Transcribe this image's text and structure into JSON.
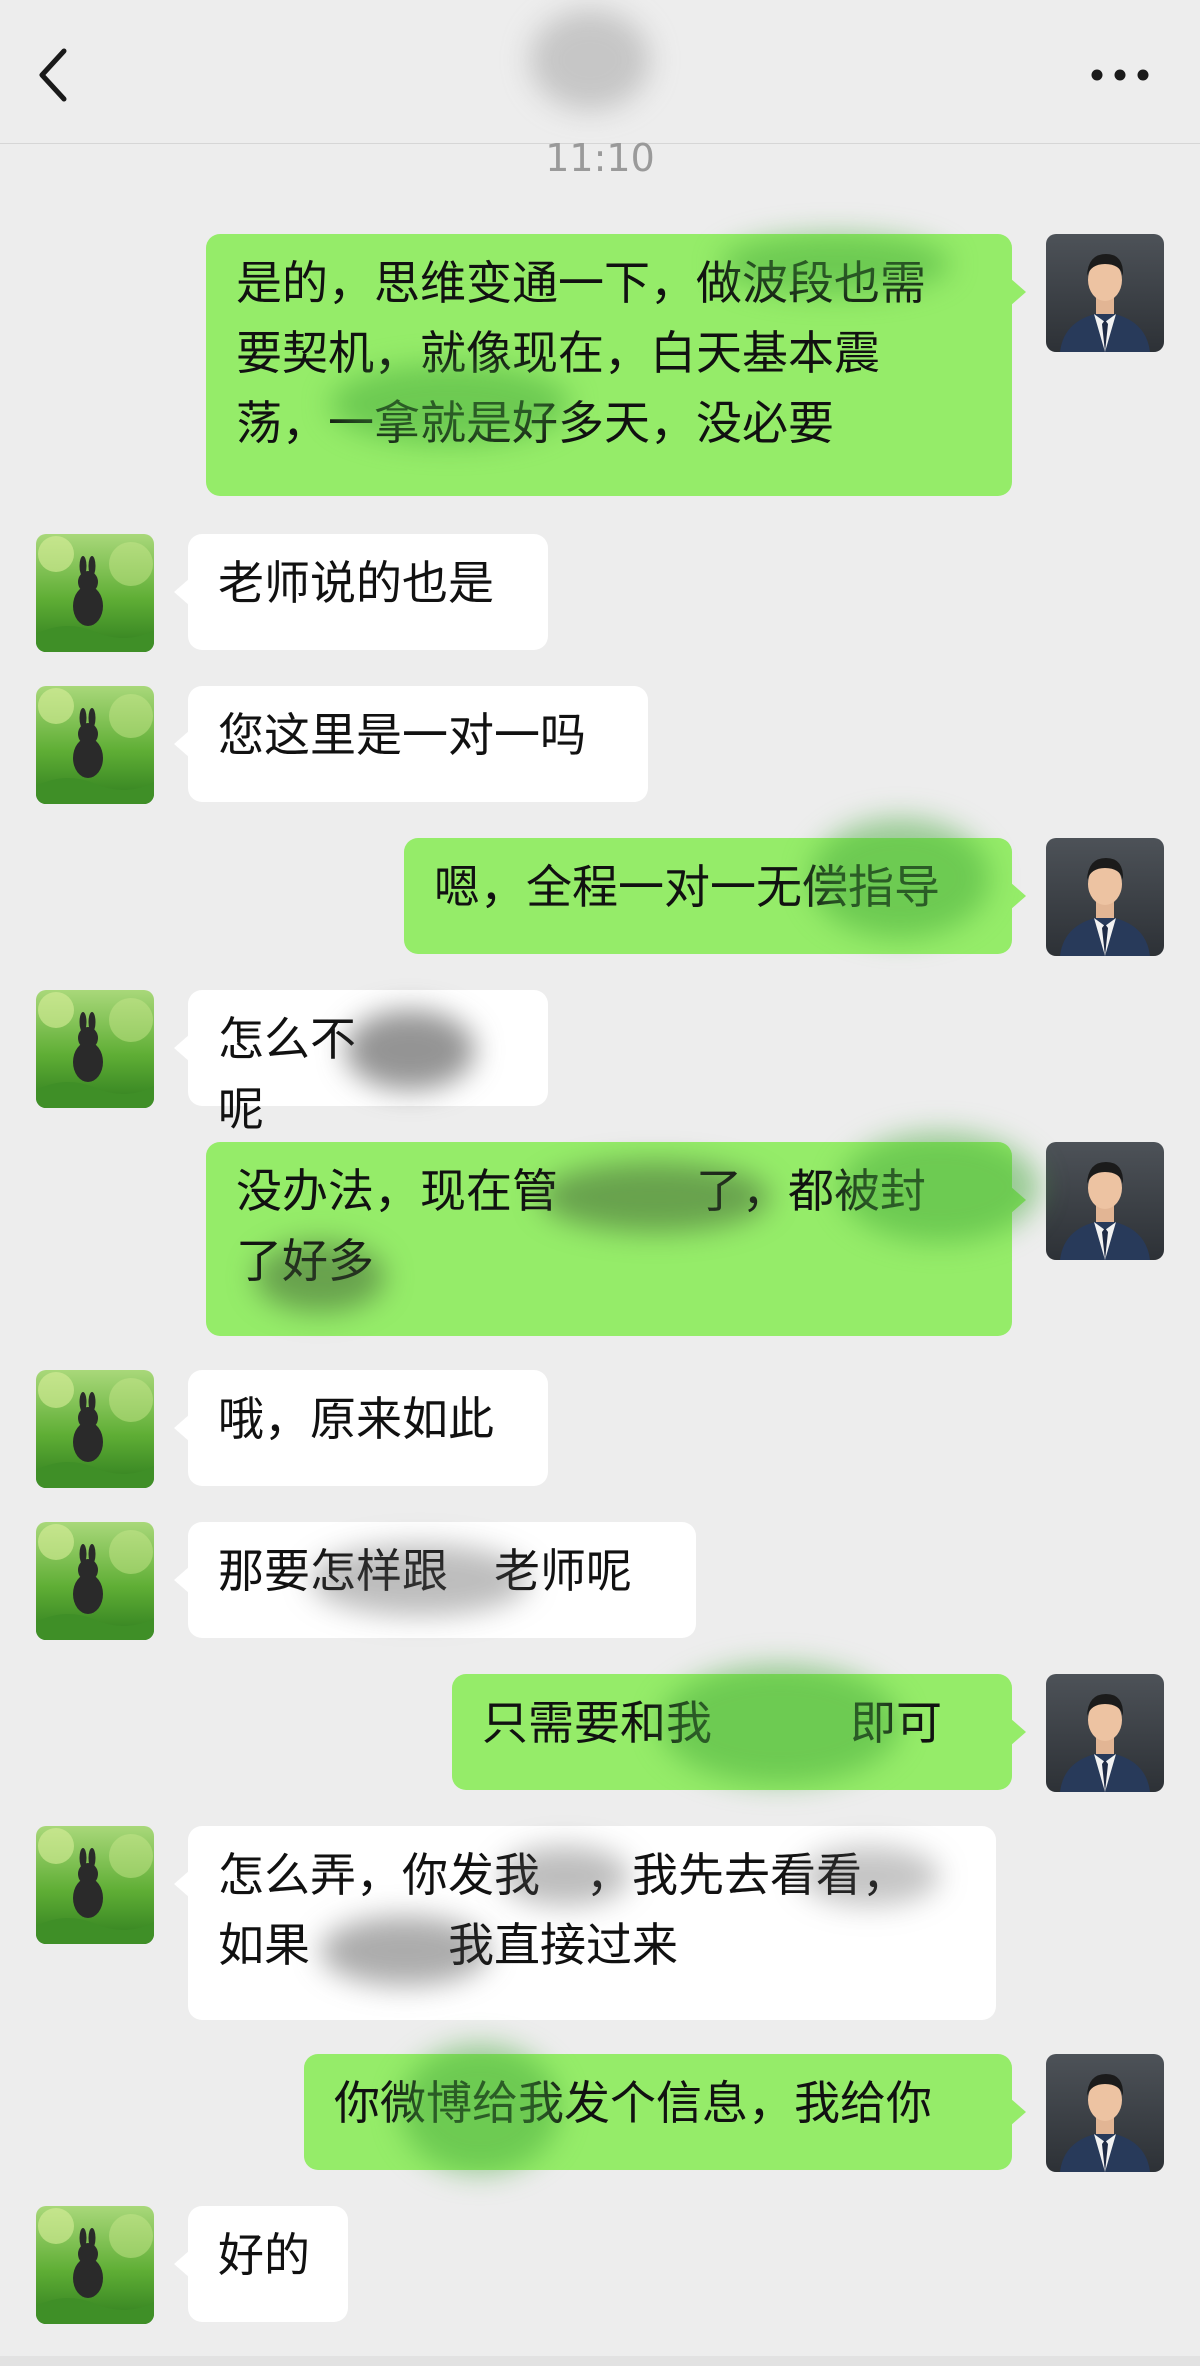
{
  "header": {
    "back_icon": "chevron-left-icon",
    "more_icon": "more-horizontal-icon",
    "title": ""
  },
  "timestamp": "11:10",
  "colors": {
    "background": "#ededed",
    "outgoing_bubble": "#95ec69",
    "incoming_bubble": "#ffffff",
    "timestamp_text": "#9a9a9a"
  },
  "messages": [
    {
      "side": "out",
      "text": "是的，思维变通一下，做波段也需\n要契机，就像现在，白天基本震\n荡，一拿就是好多天，没必要"
    },
    {
      "side": "in",
      "text": "老师说的也是"
    },
    {
      "side": "in",
      "text": "您这里是一对一吗"
    },
    {
      "side": "out",
      "text": "嗯，全程一对一无偿指导"
    },
    {
      "side": "in",
      "text": "怎么不　　　呢"
    },
    {
      "side": "out",
      "text": "没办法，现在管　　　了，都被封\n了好多"
    },
    {
      "side": "in",
      "text": "哦，原来如此"
    },
    {
      "side": "in",
      "text": "那要怎样跟　老师呢"
    },
    {
      "side": "out",
      "text": "只需要和我　　　即可"
    },
    {
      "side": "in",
      "text": "怎么弄，你发我　，我先去看看，\n如果　　　我直接过来"
    },
    {
      "side": "out",
      "text": "你微博给我发个信息，我给你"
    },
    {
      "side": "in",
      "text": "好的"
    }
  ]
}
